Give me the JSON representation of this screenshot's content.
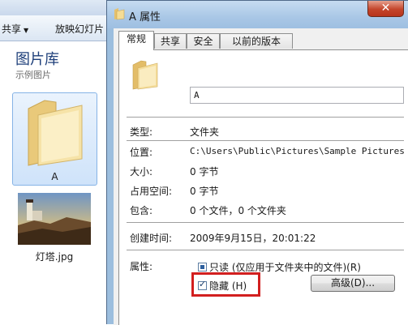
{
  "explorer": {
    "toolbar": {
      "share_label": "共享",
      "slideshow_label": "放映幻灯片"
    },
    "library": {
      "title": "图片库",
      "subtitle": "示例图片"
    },
    "items": [
      {
        "label": "A",
        "icon": "folder-icon",
        "selected": true
      },
      {
        "label": "灯塔.jpg",
        "icon": "image-thumbnail"
      }
    ]
  },
  "dialog": {
    "title": "A 属性",
    "close_icon": "close-icon",
    "tabs": [
      {
        "label": "常规",
        "active": true
      },
      {
        "label": "共享"
      },
      {
        "label": "安全"
      },
      {
        "label": "以前的版本"
      }
    ],
    "name_value": "A",
    "fields": {
      "type": {
        "label": "类型:",
        "value": "文件夹"
      },
      "location": {
        "label": "位置:",
        "value": "C:\\Users\\Public\\Pictures\\Sample Pictures"
      },
      "size": {
        "label": "大小:",
        "value": "0 字节"
      },
      "size_on_disk": {
        "label": "占用空间:",
        "value": "0 字节"
      },
      "contains": {
        "label": "包含:",
        "value": "0 个文件，0 个文件夹"
      },
      "created": {
        "label": "创建时间:",
        "value": "2009年9月15日，20:01:22"
      }
    },
    "attributes": {
      "label": "属性:",
      "readonly": {
        "label": "只读 (仅应用于文件夹中的文件)(R)",
        "state": "indeterminate"
      },
      "hidden": {
        "label": "隐藏 (H)",
        "checked": true
      },
      "advanced_button": "高级(D)..."
    },
    "highlight_color": "#d21f1f"
  }
}
